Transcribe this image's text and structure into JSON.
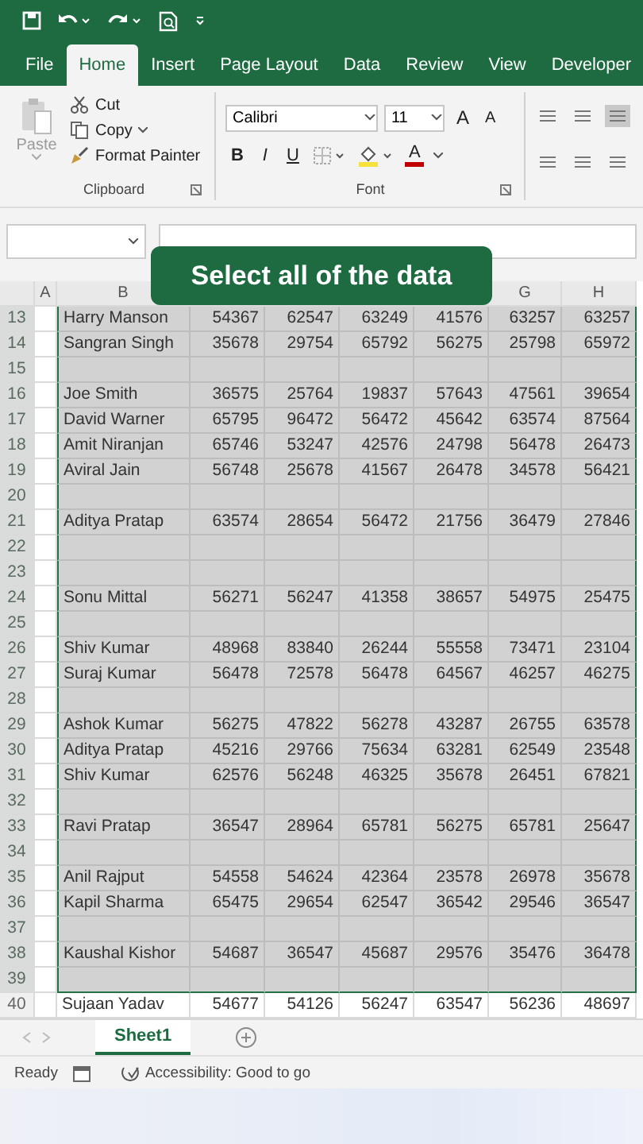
{
  "ribbon_tabs": [
    {
      "label": "File",
      "selected": false
    },
    {
      "label": "Home",
      "selected": true
    },
    {
      "label": "Insert",
      "selected": false
    },
    {
      "label": "Page Layout",
      "selected": false
    },
    {
      "label": "Data",
      "selected": false
    },
    {
      "label": "Review",
      "selected": false
    },
    {
      "label": "View",
      "selected": false
    },
    {
      "label": "Developer",
      "selected": false
    }
  ],
  "clipboard": {
    "paste": {
      "label": "Paste",
      "disabled": true
    },
    "commands": [
      "Cut",
      "Copy",
      "Format Painter"
    ],
    "group_label": "Clipboard"
  },
  "font": {
    "name": "Calibri",
    "size": "11",
    "size_buttons": [
      "A",
      "A"
    ],
    "style_buttons": [
      "B",
      "I",
      "U"
    ],
    "font_color_label": "A",
    "group_label": "Font"
  },
  "callout": "Select all of the data",
  "sheet": {
    "column_headers": {
      "left": [
        "A",
        "B"
      ],
      "right": [
        "G",
        "H"
      ]
    },
    "rows": [
      {
        "number": "13",
        "selected": true,
        "cells": [
          "Harry Manson",
          "54367",
          "62547",
          "63249",
          "41576",
          "63257",
          "63257"
        ]
      },
      {
        "number": "14",
        "selected": true,
        "cells": [
          "Sangran Singh",
          "35678",
          "29754",
          "65792",
          "56275",
          "25798",
          "65972"
        ]
      },
      {
        "number": "15",
        "selected": true,
        "cells": []
      },
      {
        "number": "16",
        "selected": true,
        "cells": [
          "Joe Smith",
          "36575",
          "25764",
          "19837",
          "57643",
          "47561",
          "39654"
        ]
      },
      {
        "number": "17",
        "selected": true,
        "cells": [
          "David Warner",
          "65795",
          "96472",
          "56472",
          "45642",
          "63574",
          "87564"
        ]
      },
      {
        "number": "18",
        "selected": true,
        "cells": [
          "Amit Niranjan",
          "65746",
          "53247",
          "42576",
          "24798",
          "56478",
          "26473"
        ]
      },
      {
        "number": "19",
        "selected": true,
        "cells": [
          "Aviral Jain",
          "56748",
          "25678",
          "41567",
          "26478",
          "34578",
          "56421"
        ]
      },
      {
        "number": "20",
        "selected": true,
        "cells": []
      },
      {
        "number": "21",
        "selected": true,
        "cells": [
          "Aditya Pratap",
          "63574",
          "28654",
          "56472",
          "21756",
          "36479",
          "27846"
        ]
      },
      {
        "number": "22",
        "selected": true,
        "cells": []
      },
      {
        "number": "23",
        "selected": true,
        "cells": []
      },
      {
        "number": "24",
        "selected": true,
        "cells": [
          "Sonu Mittal",
          "56271",
          "56247",
          "41358",
          "38657",
          "54975",
          "25475"
        ]
      },
      {
        "number": "25",
        "selected": true,
        "cells": []
      },
      {
        "number": "26",
        "selected": true,
        "cells": [
          "Shiv Kumar",
          "48968",
          "83840",
          "26244",
          "55558",
          "73471",
          "23104"
        ]
      },
      {
        "number": "27",
        "selected": true,
        "cells": [
          "Suraj Kumar",
          "56478",
          "72578",
          "56478",
          "64567",
          "46257",
          "46275"
        ]
      },
      {
        "number": "28",
        "selected": true,
        "cells": []
      },
      {
        "number": "29",
        "selected": true,
        "cells": [
          "Ashok Kumar",
          "56275",
          "47822",
          "56278",
          "43287",
          "26755",
          "63578"
        ]
      },
      {
        "number": "30",
        "selected": true,
        "cells": [
          "Aditya Pratap",
          "45216",
          "29766",
          "75634",
          "63281",
          "62549",
          "23548"
        ]
      },
      {
        "number": "31",
        "selected": true,
        "cells": [
          "Shiv Kumar",
          "62576",
          "56248",
          "46325",
          "35678",
          "26451",
          "67821"
        ]
      },
      {
        "number": "32",
        "selected": true,
        "cells": []
      },
      {
        "number": "33",
        "selected": true,
        "cells": [
          "Ravi Pratap",
          "36547",
          "28964",
          "65781",
          "56275",
          "65781",
          "25647"
        ]
      },
      {
        "number": "34",
        "selected": true,
        "cells": []
      },
      {
        "number": "35",
        "selected": true,
        "cells": [
          "Anil Rajput",
          "54558",
          "54624",
          "42364",
          "23578",
          "26978",
          "35678"
        ]
      },
      {
        "number": "36",
        "selected": true,
        "cells": [
          "Kapil Sharma",
          "65475",
          "29654",
          "62547",
          "36542",
          "29546",
          "36547"
        ]
      },
      {
        "number": "37",
        "selected": true,
        "cells": []
      },
      {
        "number": "38",
        "selected": true,
        "cells": [
          "Kaushal Kishor",
          "54687",
          "36547",
          "45687",
          "29576",
          "35476",
          "36478"
        ]
      },
      {
        "number": "39",
        "selected": true,
        "cells": []
      },
      {
        "number": "40",
        "selected": false,
        "cells": [
          "Sujaan Yadav",
          "54677",
          "54126",
          "56247",
          "63547",
          "56236",
          "48697"
        ]
      }
    ]
  },
  "sheet_tabs": [
    {
      "label": "Sheet1",
      "selected": true
    }
  ],
  "status_bar": {
    "mode": "Ready",
    "accessibility": "Accessibility: Good to go"
  }
}
